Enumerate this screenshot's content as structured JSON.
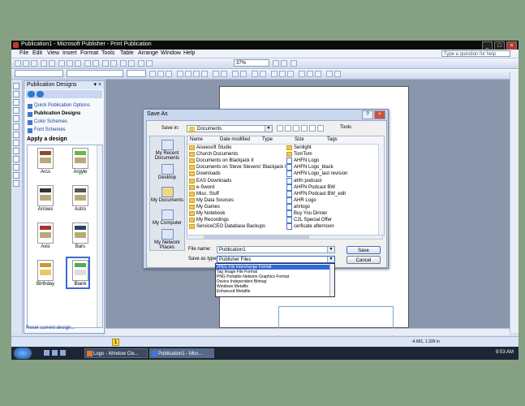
{
  "window": {
    "title": "Publication1 - Microsoft Publisher - Print Publication"
  },
  "menu": [
    "File",
    "Edit",
    "View",
    "Insert",
    "Format",
    "Tools",
    "Table",
    "Arrange",
    "Window",
    "Help"
  ],
  "help_placeholder": "Type a question for help",
  "toolbar": {
    "zoom": "37%"
  },
  "taskpane": {
    "title": "Publication Designs",
    "links": [
      "Quick Publication Options",
      "Publication Designs",
      "Color Schemes",
      "Font Schemes"
    ],
    "apply_heading": "Apply a design",
    "designs": [
      "Arcs",
      "Argyle",
      "Arrows",
      "Astro",
      "Axis",
      "Bars",
      "Birthday",
      "Blank"
    ],
    "reset": "Reset current design..."
  },
  "dialog": {
    "title": "Save As",
    "save_in_label": "Save in:",
    "save_in_value": "Documents",
    "tools_label": "Tools",
    "places": [
      "My Recent Documents",
      "Desktop",
      "My Documents",
      "My Computer",
      "My Network Places"
    ],
    "columns": [
      "Name",
      "Date modified",
      "Type",
      "Size",
      "Tags"
    ],
    "files_col1": [
      "Aiseesoft Studio",
      "Church Documents",
      "Documents on Blackjack II",
      "Documents on Steve Stevens' Blackjack II",
      "Downloads",
      "EAS Downloads",
      "e-Sword",
      "Misc. Stuff",
      "My Data Sources",
      "My Games",
      "My Notebook",
      "My Recordings",
      "ServiceCEO Database Backups"
    ],
    "files_col2": [
      "Senlight",
      "TomTom",
      "AHFN Logo",
      "AHFN Logo_black",
      "AHFN Logo_last revision",
      "ahfn podcast",
      "AHFN Podcast BW",
      "AHFN Podcast BW_edit",
      "AHR Logo",
      "ahrlogo",
      "Buy You Dinner",
      "C2L Special Offer",
      "cerficate afternoon"
    ],
    "file_name_label": "File name:",
    "file_name_value": "Publication1",
    "save_type_label": "Save as type:",
    "save_type_value": "Publisher Files",
    "save_button": "Save",
    "cancel_button": "Cancel",
    "type_options": [
      "JPEG File Interchange Format",
      "Tag Image File Format",
      "PNG Portable Network Graphics Format",
      "Device Independent Bitmap",
      "Windows Metafile",
      "Enhanced Metafile"
    ]
  },
  "status": {
    "page": "1",
    "coords": "-4.661, 1.339 in."
  },
  "taskbar": {
    "buttons": [
      "Logo - Window Cle...",
      "Publication1 - Micr..."
    ],
    "clock": "9:53 AM"
  }
}
